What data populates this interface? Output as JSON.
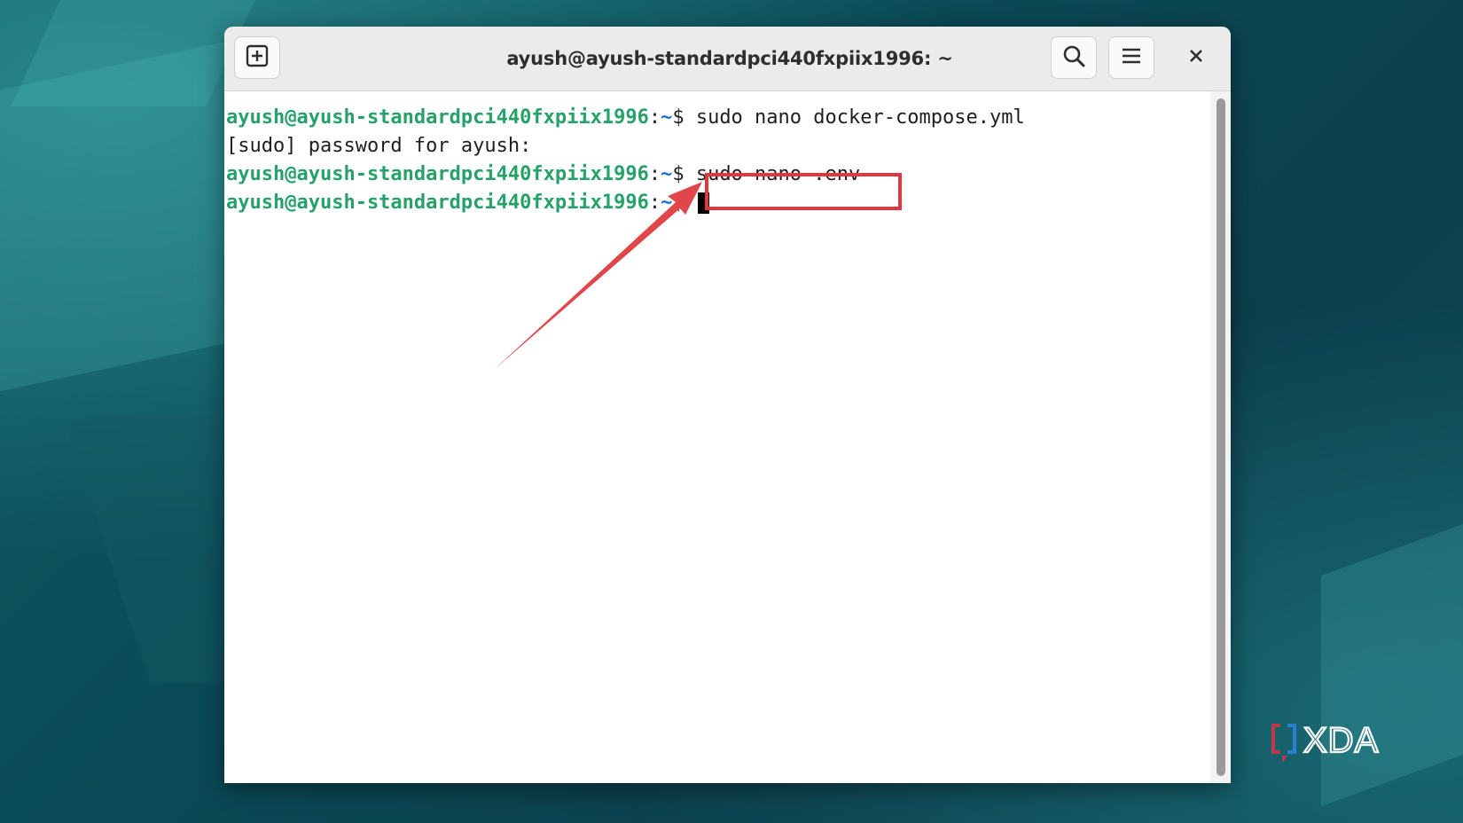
{
  "window": {
    "title": "ayush@ayush-standardpci440fxpiix1996: ~",
    "buttons": {
      "new_tab": "new-tab-icon",
      "search": "search-icon",
      "menu": "hamburger-menu-icon",
      "close": "close-icon"
    }
  },
  "terminal": {
    "lines": [
      {
        "user": "ayush@ayush-standardpci440fxpiix1996",
        "colon": ":",
        "dir": "~",
        "dollar": "$",
        "command": " sudo nano docker-compose.yml"
      },
      {
        "text": "[sudo] password for ayush:"
      },
      {
        "user": "ayush@ayush-standardpci440fxpiix1996",
        "colon": ":",
        "dir": "~",
        "dollar": "$",
        "command": " sudo nano .env"
      },
      {
        "user": "ayush@ayush-standardpci440fxpiix1996",
        "colon": ":",
        "dir": "~",
        "dollar": "$",
        "command": " "
      }
    ]
  },
  "annotation": {
    "highlight_color": "#e3373d",
    "arrow_color": "#e0464a"
  },
  "brand": {
    "logo_text": "XDA",
    "logo_color": "#ffffff",
    "bracket_color": "#c0394a"
  }
}
